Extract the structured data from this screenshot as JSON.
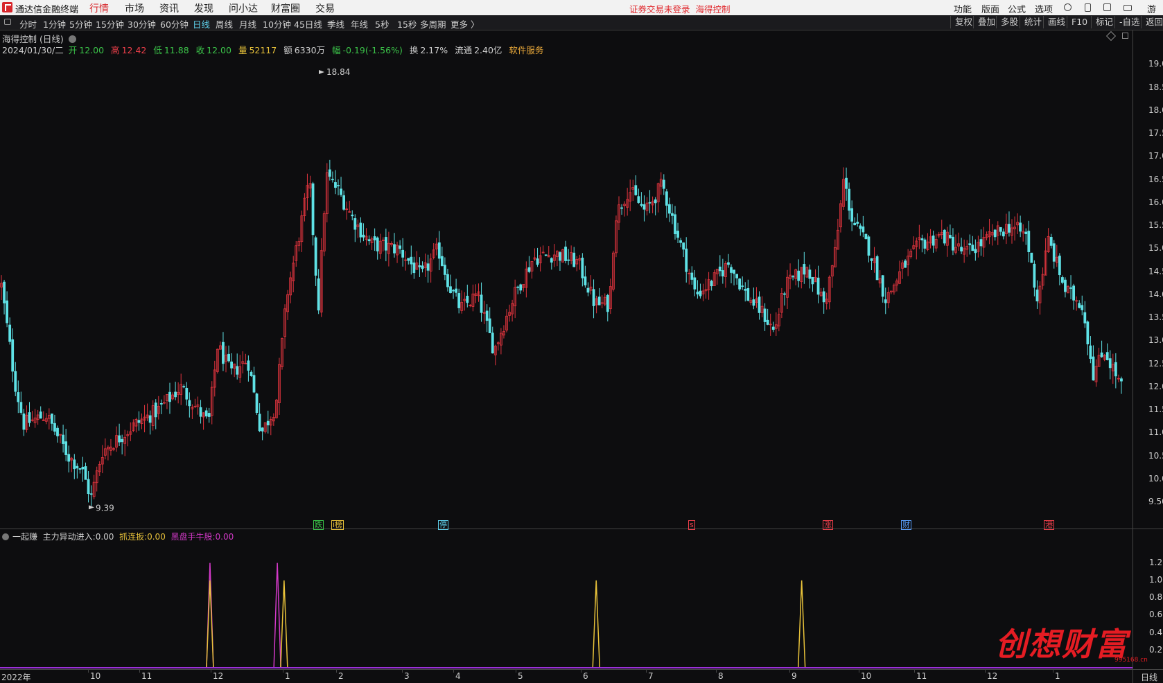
{
  "app": {
    "title": "通达信金融终端",
    "nav": [
      "行情",
      "市场",
      "资讯",
      "发现",
      "问小达",
      "财富圈",
      "交易"
    ],
    "active_nav": "行情",
    "notice": "证券交易未登录",
    "notice_stock": "海得控制",
    "right_menu": [
      "功能",
      "版面",
      "公式",
      "选项"
    ],
    "user": "游客"
  },
  "periods": {
    "items": [
      "分时",
      "1分钟",
      "5分钟",
      "15分钟",
      "30分钟",
      "60分钟",
      "日线",
      "周线",
      "月线",
      "10分钟",
      "45日线",
      "季线",
      "年线",
      "5秒",
      "15秒",
      "多周期",
      "更多 〉"
    ],
    "active": "日线",
    "right_tools": [
      "复权",
      "叠加",
      "多股",
      "统计",
      "画线",
      "F10",
      "标记",
      "-自选",
      "返回"
    ]
  },
  "stock": {
    "title": "海得控制 (日线)",
    "date": "2024/01/30/二",
    "open_label": "开",
    "open": "12.00",
    "high_label": "高",
    "high": "12.42",
    "low_label": "低",
    "low": "11.88",
    "close_label": "收",
    "close": "12.00",
    "volume_label": "量",
    "volume": "52117",
    "amount_label": "额",
    "amount": "6330万",
    "change_label": "幅",
    "change": "-0.19(-1.56%)",
    "turnover_label": "换",
    "turnover": "2.17%",
    "float_label": "流通",
    "float": "2.40亿",
    "industry": "软件服务",
    "max_label": "18.84",
    "min_label": "9.39"
  },
  "axis": {
    "price_ticks": [
      "19.00",
      "18.50",
      "18.00",
      "17.50",
      "17.00",
      "16.50",
      "16.00",
      "15.50",
      "15.00",
      "14.50",
      "14.00",
      "13.50",
      "13.00",
      "12.50",
      "12.00",
      "11.50",
      "11.00",
      "10.50",
      "10.00",
      "9.50"
    ],
    "indicator_ticks": [
      "1.20",
      "1.00",
      "0.80",
      "0.60",
      "0.40",
      "0.20"
    ],
    "months": [
      "2022年",
      "10",
      "11",
      "12",
      "1",
      "2",
      "3",
      "4",
      "5",
      "6",
      "7",
      "8",
      "9",
      "10",
      "11",
      "12",
      "1"
    ],
    "period_label": "日线"
  },
  "signals": [
    {
      "text": "跌",
      "color": "#3bc449"
    },
    {
      "text": "i榜",
      "color": "#e8c23a"
    },
    {
      "text": "停",
      "color": "#5fd3ee"
    },
    {
      "text": "s",
      "color": "#ee3f4a"
    },
    {
      "text": "涨",
      "color": "#ee3f4a"
    },
    {
      "text": "财",
      "color": "#5aa0ff"
    },
    {
      "text": "港",
      "color": "#ee3f4a"
    }
  ],
  "indicator": {
    "name": "一起赚",
    "s1_label": "主力异动进入:",
    "s1_value": "0.00",
    "s2_label": "抓连扳:",
    "s2_value": "0.00",
    "s3_label": "黑盘手牛股:",
    "s3_value": "0.00"
  },
  "watermark": {
    "text": "创想财富",
    "url": "995168.cn"
  },
  "chart_data": {
    "type": "candlestick",
    "title": "海得控制 (日线)",
    "ylim": [
      9.2,
      19.2
    ],
    "high_max": 18.84,
    "low_min": 9.39,
    "last": {
      "date": "2024/01/30",
      "open": 12.0,
      "high": 12.42,
      "low": 11.88,
      "close": 12.0
    },
    "close_anchors": [
      {
        "x": 0.0,
        "y": 14.2
      },
      {
        "x": 0.012,
        "y": 12.1
      },
      {
        "x": 0.02,
        "y": 11.2
      },
      {
        "x": 0.04,
        "y": 11.4
      },
      {
        "x": 0.06,
        "y": 10.5
      },
      {
        "x": 0.072,
        "y": 10.2
      },
      {
        "x": 0.08,
        "y": 9.6
      },
      {
        "x": 0.09,
        "y": 10.6
      },
      {
        "x": 0.12,
        "y": 11.2
      },
      {
        "x": 0.14,
        "y": 11.5
      },
      {
        "x": 0.16,
        "y": 12.0
      },
      {
        "x": 0.185,
        "y": 11.2
      },
      {
        "x": 0.193,
        "y": 12.9
      },
      {
        "x": 0.205,
        "y": 12.3
      },
      {
        "x": 0.22,
        "y": 12.6
      },
      {
        "x": 0.232,
        "y": 11.0
      },
      {
        "x": 0.245,
        "y": 11.6
      },
      {
        "x": 0.255,
        "y": 14.0
      },
      {
        "x": 0.265,
        "y": 15.2
      },
      {
        "x": 0.275,
        "y": 16.5
      },
      {
        "x": 0.283,
        "y": 13.7
      },
      {
        "x": 0.29,
        "y": 16.6
      },
      {
        "x": 0.3,
        "y": 16.3
      },
      {
        "x": 0.315,
        "y": 15.6
      },
      {
        "x": 0.33,
        "y": 15.1
      },
      {
        "x": 0.355,
        "y": 15.0
      },
      {
        "x": 0.375,
        "y": 14.4
      },
      {
        "x": 0.39,
        "y": 15.0
      },
      {
        "x": 0.4,
        "y": 14.2
      },
      {
        "x": 0.41,
        "y": 13.7
      },
      {
        "x": 0.425,
        "y": 14.0
      },
      {
        "x": 0.44,
        "y": 12.8
      },
      {
        "x": 0.458,
        "y": 14.0
      },
      {
        "x": 0.475,
        "y": 14.8
      },
      {
        "x": 0.495,
        "y": 14.9
      },
      {
        "x": 0.515,
        "y": 14.7
      },
      {
        "x": 0.53,
        "y": 13.8
      },
      {
        "x": 0.543,
        "y": 13.8
      },
      {
        "x": 0.548,
        "y": 15.7
      },
      {
        "x": 0.56,
        "y": 16.3
      },
      {
        "x": 0.575,
        "y": 15.8
      },
      {
        "x": 0.59,
        "y": 16.4
      },
      {
        "x": 0.605,
        "y": 15.2
      },
      {
        "x": 0.62,
        "y": 14.0
      },
      {
        "x": 0.635,
        "y": 14.3
      },
      {
        "x": 0.65,
        "y": 14.7
      },
      {
        "x": 0.665,
        "y": 14.0
      },
      {
        "x": 0.68,
        "y": 13.6
      },
      {
        "x": 0.69,
        "y": 13.2
      },
      {
        "x": 0.7,
        "y": 14.2
      },
      {
        "x": 0.72,
        "y": 14.6
      },
      {
        "x": 0.735,
        "y": 13.8
      },
      {
        "x": 0.745,
        "y": 15.0
      },
      {
        "x": 0.752,
        "y": 16.5
      },
      {
        "x": 0.76,
        "y": 15.6
      },
      {
        "x": 0.775,
        "y": 15.0
      },
      {
        "x": 0.79,
        "y": 13.9
      },
      {
        "x": 0.805,
        "y": 14.6
      },
      {
        "x": 0.82,
        "y": 15.1
      },
      {
        "x": 0.84,
        "y": 15.3
      },
      {
        "x": 0.86,
        "y": 14.9
      },
      {
        "x": 0.88,
        "y": 15.2
      },
      {
        "x": 0.9,
        "y": 15.5
      },
      {
        "x": 0.915,
        "y": 15.3
      },
      {
        "x": 0.925,
        "y": 13.9
      },
      {
        "x": 0.935,
        "y": 15.2
      },
      {
        "x": 0.95,
        "y": 14.1
      },
      {
        "x": 0.965,
        "y": 13.8
      },
      {
        "x": 0.975,
        "y": 12.3
      },
      {
        "x": 0.985,
        "y": 12.8
      },
      {
        "x": 1.0,
        "y": 12.0
      }
    ],
    "indicator_spikes": [
      {
        "series": "主力异动进入",
        "pos": 0.187,
        "value": 1.2,
        "color": "#d339c8"
      },
      {
        "series": "主力异动进入",
        "pos": 0.247,
        "value": 1.2,
        "color": "#d339c8"
      },
      {
        "series": "抓连扳",
        "pos": 0.187,
        "value": 1.0,
        "color": "#e8c23a"
      },
      {
        "series": "抓连扳",
        "pos": 0.253,
        "value": 1.0,
        "color": "#e8c23a"
      },
      {
        "series": "抓连扳",
        "pos": 0.531,
        "value": 1.0,
        "color": "#e8c23a"
      },
      {
        "series": "抓连扳",
        "pos": 0.714,
        "value": 1.0,
        "color": "#e8c23a"
      }
    ],
    "indicator_ylim": [
      0,
      1.3
    ]
  }
}
